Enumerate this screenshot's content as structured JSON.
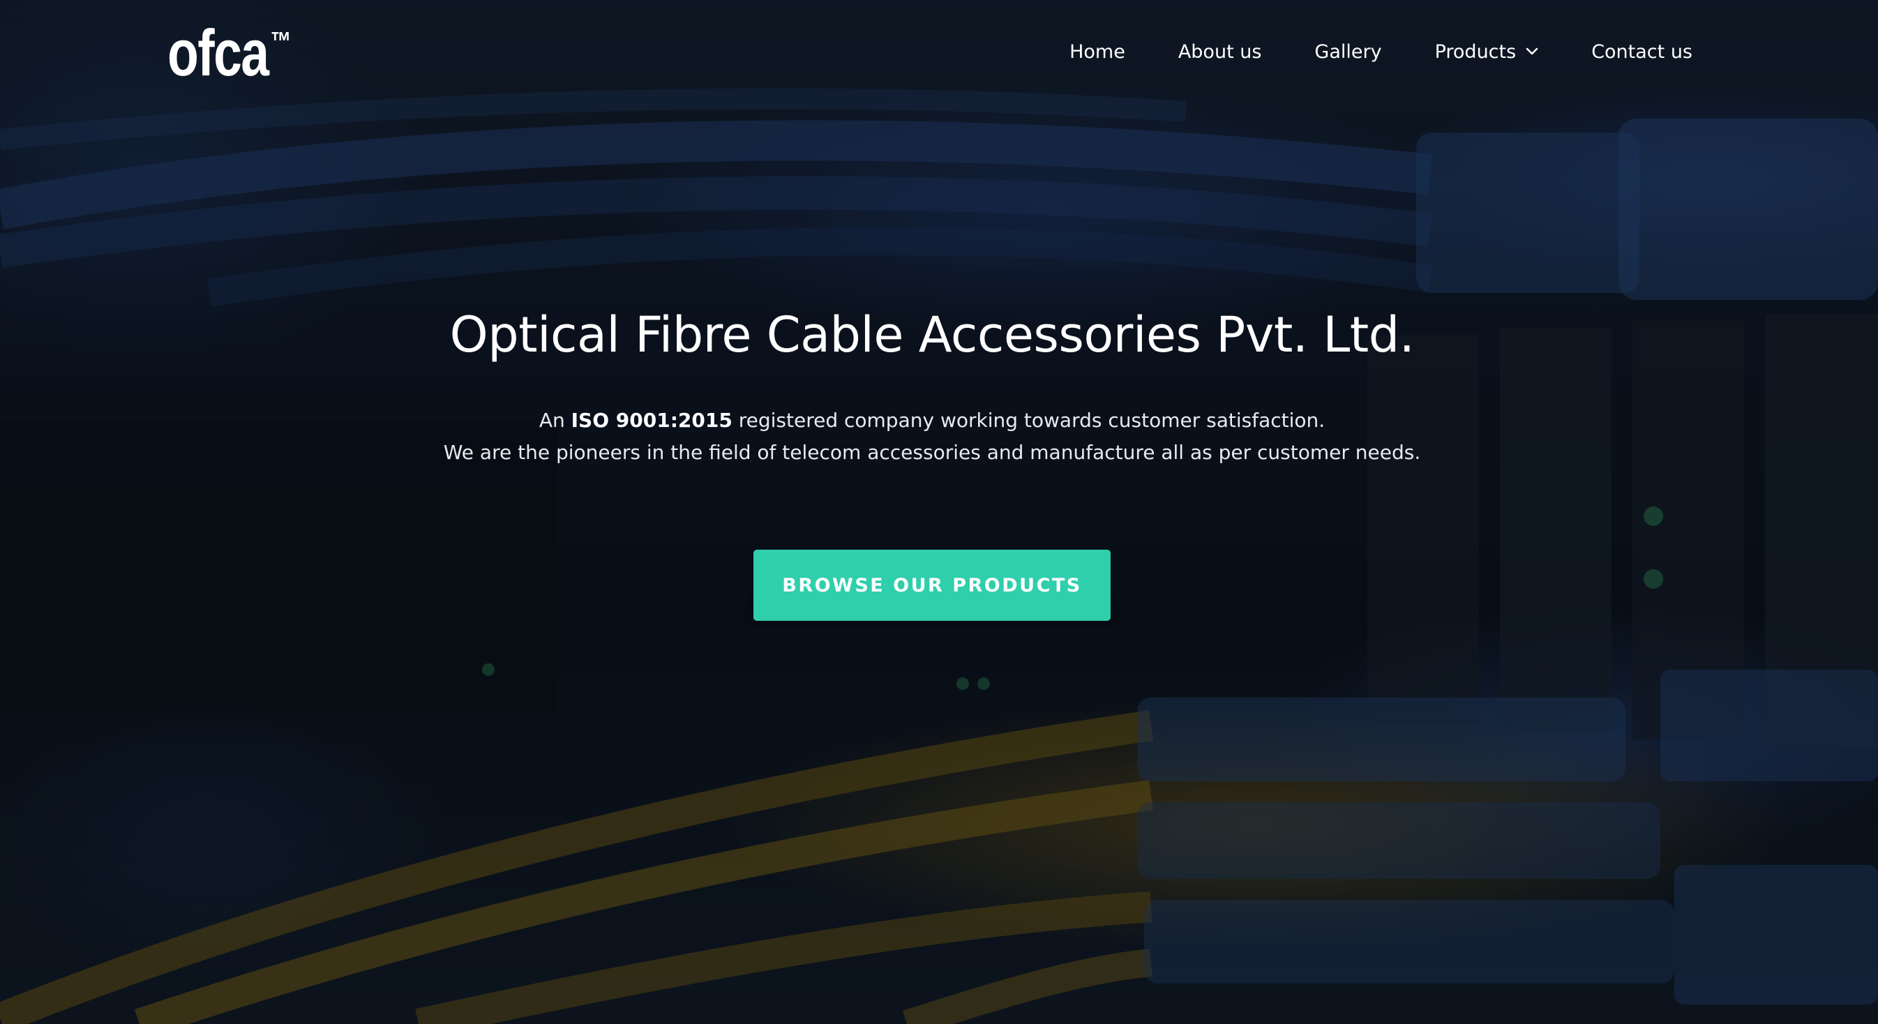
{
  "brand": {
    "name": "ofca",
    "trademark": "™"
  },
  "nav": {
    "items": [
      {
        "label": "Home"
      },
      {
        "label": "About us"
      },
      {
        "label": "Gallery"
      },
      {
        "label": "Products",
        "icon": "chevron-down-icon"
      },
      {
        "label": "Contact us"
      }
    ]
  },
  "hero": {
    "title": "Optical Fibre Cable Accessories Pvt. Ltd.",
    "line1_prefix": "An ",
    "line1_strong": "ISO 9001:2015",
    "line1_suffix": " registered company working towards customer satisfaction.",
    "line2": "We are the pioneers in the field of telecom accessories and manufacture all as per customer needs.",
    "cta_label": "BROWSE OUR PRODUCTS"
  },
  "colors": {
    "accent": "#2fcfac",
    "text": "#ffffff",
    "background": "#0a0f18"
  }
}
